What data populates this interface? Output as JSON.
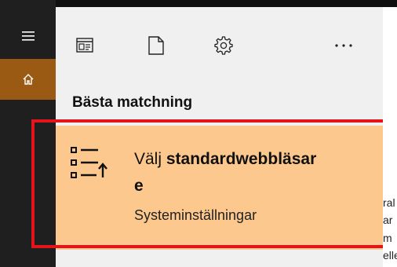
{
  "sidebar": {
    "items": [
      {
        "icon": "hamburger-menu-icon"
      },
      {
        "icon": "home-icon",
        "selected": true
      }
    ]
  },
  "toolbar": {
    "icons": [
      "documents-filter-icon",
      "document-icon",
      "settings-gear-icon",
      "more-options-icon"
    ]
  },
  "results": {
    "section_title": "Bästa matchning",
    "best_match": {
      "title_prefix": "Välj ",
      "title_bold": "standardwebbläsar",
      "title_wrap": "e",
      "subtitle": "Systeminställningar",
      "icon": "default-apps-list-icon"
    }
  },
  "background_fragments": [
    "ral",
    "ar",
    "m",
    "elle"
  ],
  "colors": {
    "rail": "#1f1f1f",
    "home_selected": "#9a5a14",
    "panel": "#f0f0f0",
    "best_match_bg": "#fcc88d",
    "highlight_border": "#e3141a"
  }
}
